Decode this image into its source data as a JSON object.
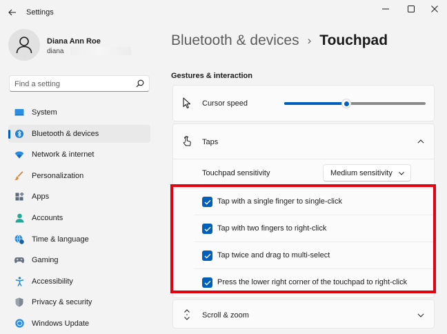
{
  "window": {
    "title": "Settings",
    "controls": [
      "minimize",
      "maximize",
      "close"
    ]
  },
  "profile": {
    "name": "Diana Ann Roe",
    "email": "diana"
  },
  "search": {
    "placeholder": "Find a setting",
    "value": ""
  },
  "sidebar": {
    "items": [
      {
        "label": "System",
        "icon": "monitor-icon"
      },
      {
        "label": "Bluetooth & devices",
        "icon": "bluetooth-icon",
        "active": true
      },
      {
        "label": "Network & internet",
        "icon": "wifi-icon"
      },
      {
        "label": "Personalization",
        "icon": "brush-icon"
      },
      {
        "label": "Apps",
        "icon": "apps-icon"
      },
      {
        "label": "Accounts",
        "icon": "person-icon"
      },
      {
        "label": "Time & language",
        "icon": "globe-clock-icon"
      },
      {
        "label": "Gaming",
        "icon": "gamepad-icon"
      },
      {
        "label": "Accessibility",
        "icon": "accessibility-icon"
      },
      {
        "label": "Privacy & security",
        "icon": "shield-icon"
      },
      {
        "label": "Windows Update",
        "icon": "update-icon"
      }
    ]
  },
  "breadcrumb": {
    "parent": "Bluetooth & devices",
    "separator": "›",
    "current": "Touchpad"
  },
  "section": {
    "title": "Gestures & interaction"
  },
  "cursor_speed": {
    "label": "Cursor speed",
    "icon": "cursor-icon",
    "value_fraction": 0.44
  },
  "taps": {
    "label": "Taps",
    "icon": "tap-icon",
    "expanded": true,
    "sensitivity": {
      "label": "Touchpad sensitivity",
      "selected": "Medium sensitivity"
    },
    "options": [
      {
        "label": "Tap with a single finger to single-click",
        "checked": true
      },
      {
        "label": "Tap with two fingers to right-click",
        "checked": true
      },
      {
        "label": "Tap twice and drag to multi-select",
        "checked": true
      },
      {
        "label": "Press the lower right corner of the touchpad to right-click",
        "checked": true
      }
    ]
  },
  "scroll_zoom": {
    "label": "Scroll & zoom",
    "icon": "scroll-icon",
    "expanded": false
  },
  "colors": {
    "accent": "#005fb8",
    "highlight": "#e3000f",
    "background": "#f3f3f3",
    "card": "#fbfbfb"
  }
}
